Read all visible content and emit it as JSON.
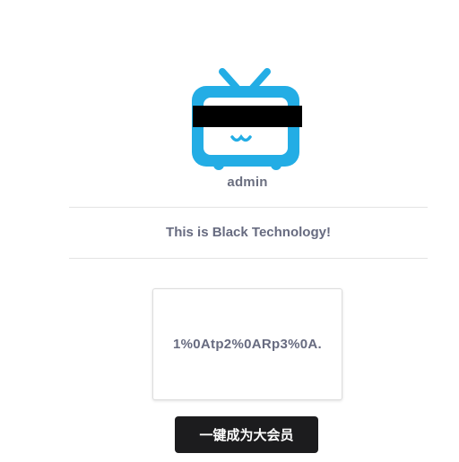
{
  "profile": {
    "avatar_icon": "tv-mascot-icon",
    "avatar_color": "#23ade5",
    "username": "admin"
  },
  "tagline": "This is Black Technology!",
  "code_card": {
    "text": "1%0Atp2%0ARp3%0A."
  },
  "action_button": {
    "label": "一键成为大会员"
  }
}
